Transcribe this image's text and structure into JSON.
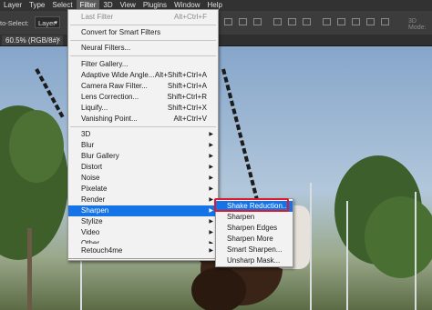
{
  "menubar": {
    "items": [
      "Layer",
      "Type",
      "Select",
      "Filter",
      "3D",
      "View",
      "Plugins",
      "Window",
      "Help"
    ],
    "active_index": 3
  },
  "options_bar": {
    "auto_select_label": "to-Select:",
    "layer_select_value": "Layer",
    "mode_3d_label": "3D Mode:"
  },
  "document_tab": {
    "label": "60.5% (RGB/8#)",
    "close_glyph": "×"
  },
  "filter_menu": {
    "items": [
      {
        "label": "Last Filter",
        "shortcut": "Alt+Ctrl+F",
        "disabled": true
      },
      {
        "label": "Convert for Smart Filters"
      },
      {
        "label": "Neural Filters..."
      },
      {
        "label": "Filter Gallery..."
      },
      {
        "label": "Adaptive Wide Angle...",
        "shortcut": "Alt+Shift+Ctrl+A"
      },
      {
        "label": "Camera Raw Filter...",
        "shortcut": "Shift+Ctrl+A"
      },
      {
        "label": "Lens Correction...",
        "shortcut": "Shift+Ctrl+R"
      },
      {
        "label": "Liquify...",
        "shortcut": "Shift+Ctrl+X"
      },
      {
        "label": "Vanishing Point...",
        "shortcut": "Alt+Ctrl+V"
      },
      {
        "label": "3D",
        "submenu": true
      },
      {
        "label": "Blur",
        "submenu": true
      },
      {
        "label": "Blur Gallery",
        "submenu": true
      },
      {
        "label": "Distort",
        "submenu": true
      },
      {
        "label": "Noise",
        "submenu": true
      },
      {
        "label": "Pixelate",
        "submenu": true
      },
      {
        "label": "Render",
        "submenu": true
      },
      {
        "label": "Sharpen",
        "submenu": true,
        "highlighted": true
      },
      {
        "label": "Stylize",
        "submenu": true
      },
      {
        "label": "Video",
        "submenu": true
      },
      {
        "label": "Other",
        "submenu": true
      },
      {
        "label": "Retouch4me",
        "submenu": true
      }
    ]
  },
  "sharpen_submenu": {
    "items": [
      {
        "label": "Shake Reduction...",
        "highlighted": true
      },
      {
        "label": "Sharpen"
      },
      {
        "label": "Sharpen Edges"
      },
      {
        "label": "Sharpen More"
      },
      {
        "label": "Smart Sharpen..."
      },
      {
        "label": "Unsharp Mask..."
      }
    ]
  },
  "colors": {
    "menu_highlight": "#1473e6",
    "annotation_red": "#e0192a",
    "menu_bg": "#f2f2f2",
    "app_chrome": "#323232"
  },
  "icons": [
    "submenu-arrow-icon",
    "align-icon",
    "dropdown-chevron-icon",
    "close-icon"
  ]
}
